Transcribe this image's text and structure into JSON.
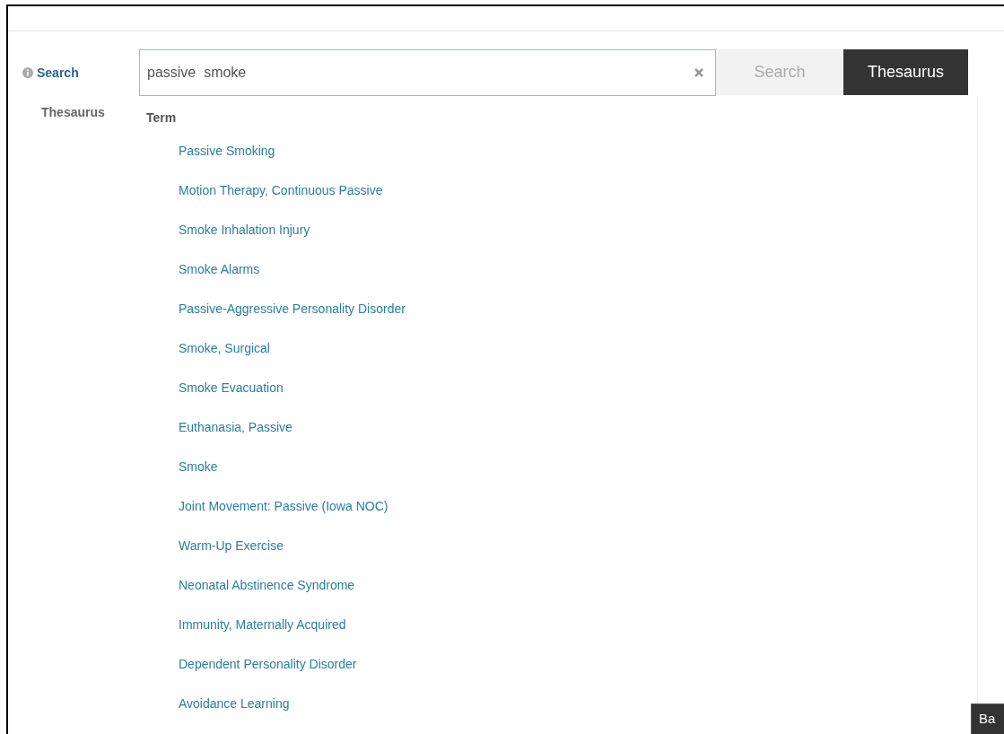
{
  "search_label": "Search",
  "thesaurus_label": "Thesaurus",
  "search_field": {
    "value": "passive  smoke"
  },
  "buttons": [
    {
      "label": "Search",
      "selected": false
    },
    {
      "label": "Thesaurus",
      "selected": true
    }
  ],
  "results": {
    "header": "Term",
    "items": [
      "Passive Smoking",
      "Motion Therapy, Continuous Passive",
      "Smoke Inhalation Injury",
      "Smoke Alarms",
      "Passive-Aggressive Personality Disorder",
      "Smoke, Surgical",
      "Smoke Evacuation",
      "Euthanasia, Passive",
      "Smoke",
      "Joint Movement: Passive (Iowa NOC)",
      "Warm-Up Exercise",
      "Neonatal Abstinence Syndrome",
      "Immunity, Maternally Acquired",
      "Dependent Personality Disorder",
      "Avoidance Learning"
    ]
  },
  "corner_button": "Ba"
}
